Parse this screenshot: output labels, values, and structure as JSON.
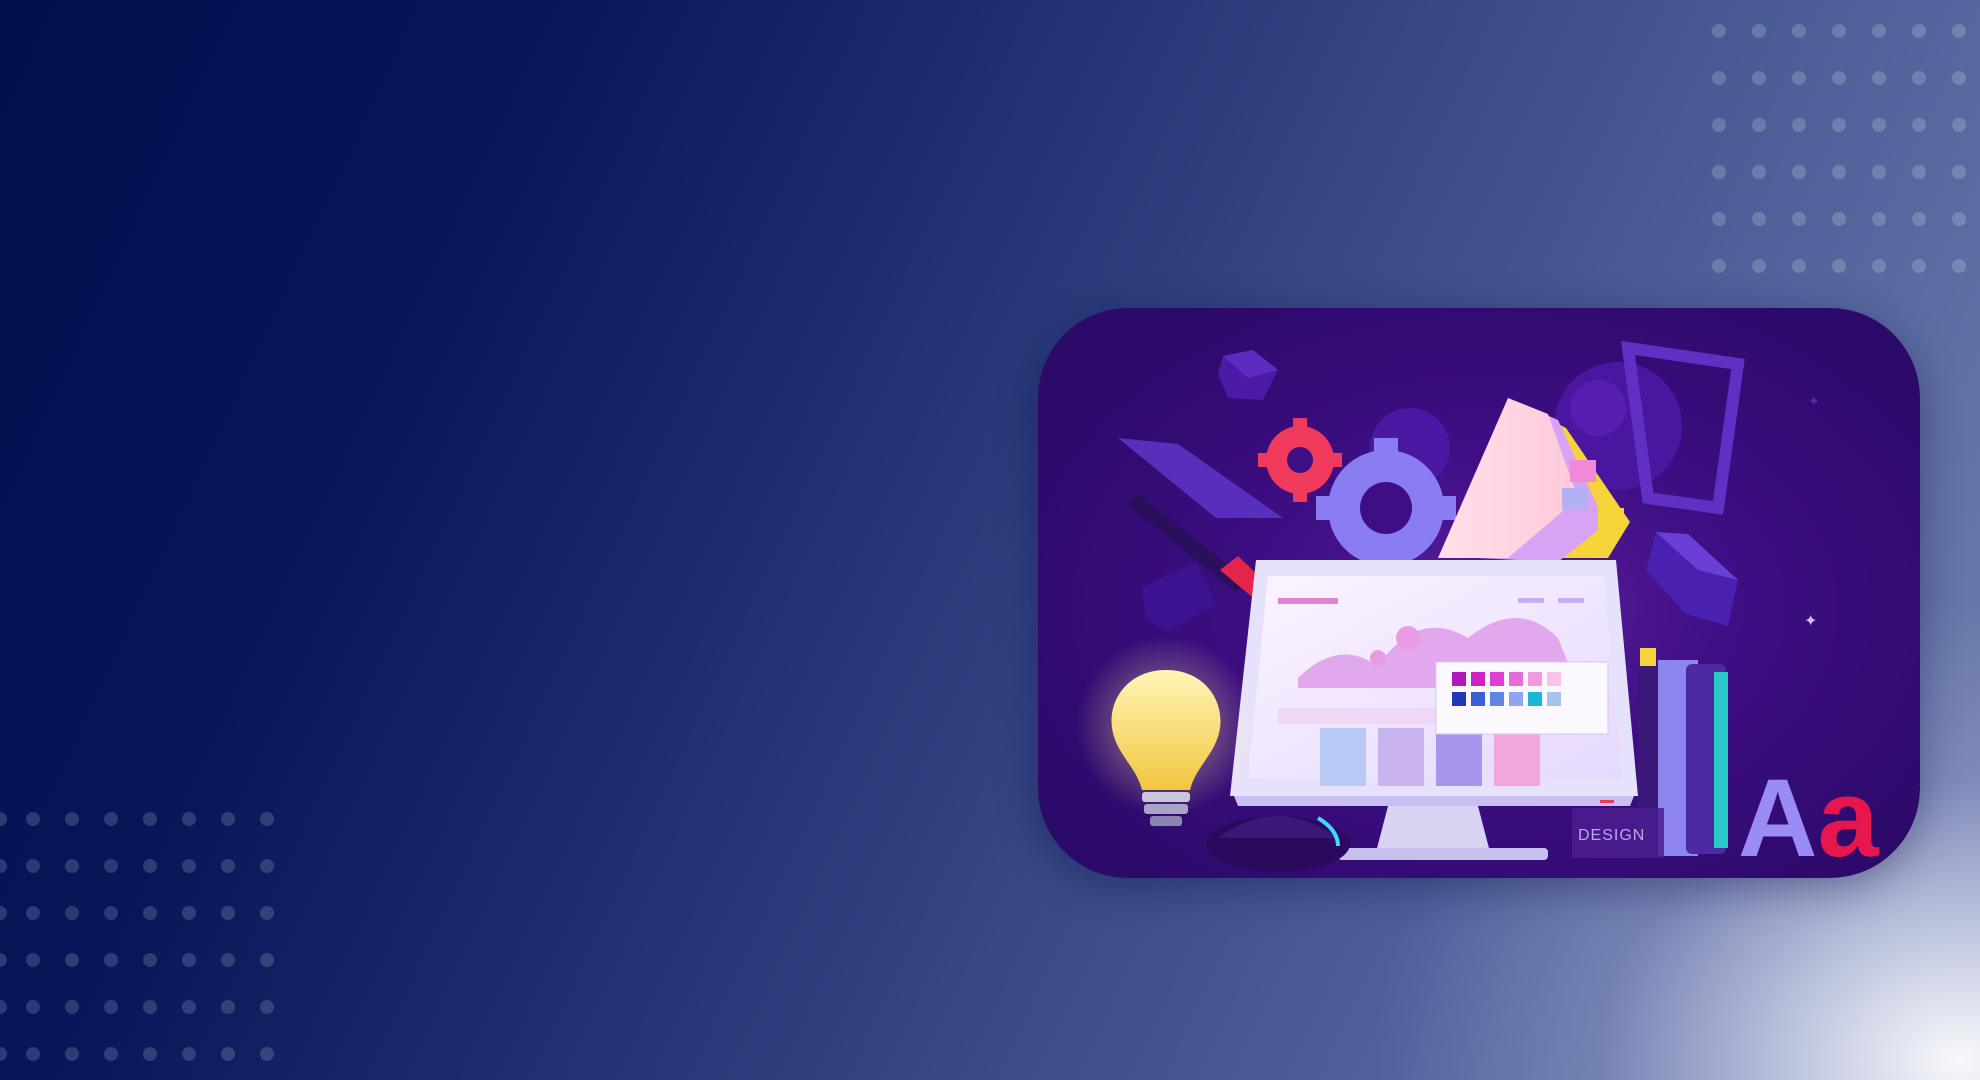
{
  "hero": {
    "illustration": {
      "monitor_label": "DESIGN",
      "typography_sample": "Aa",
      "icons": [
        "cube-icon",
        "gear-icon",
        "color-swatch-icon",
        "pen-tool-icon",
        "lightbulb-icon",
        "mouse-icon",
        "book-icon"
      ]
    }
  },
  "colors": {
    "background_dark": "#03104f",
    "background_mid": "#364886",
    "background_light": "#ffffff",
    "card_purple": "#3e0e84",
    "accent_pink": "#e03a8c",
    "accent_red": "#f0345a",
    "accent_violet": "#9b8cf5"
  }
}
